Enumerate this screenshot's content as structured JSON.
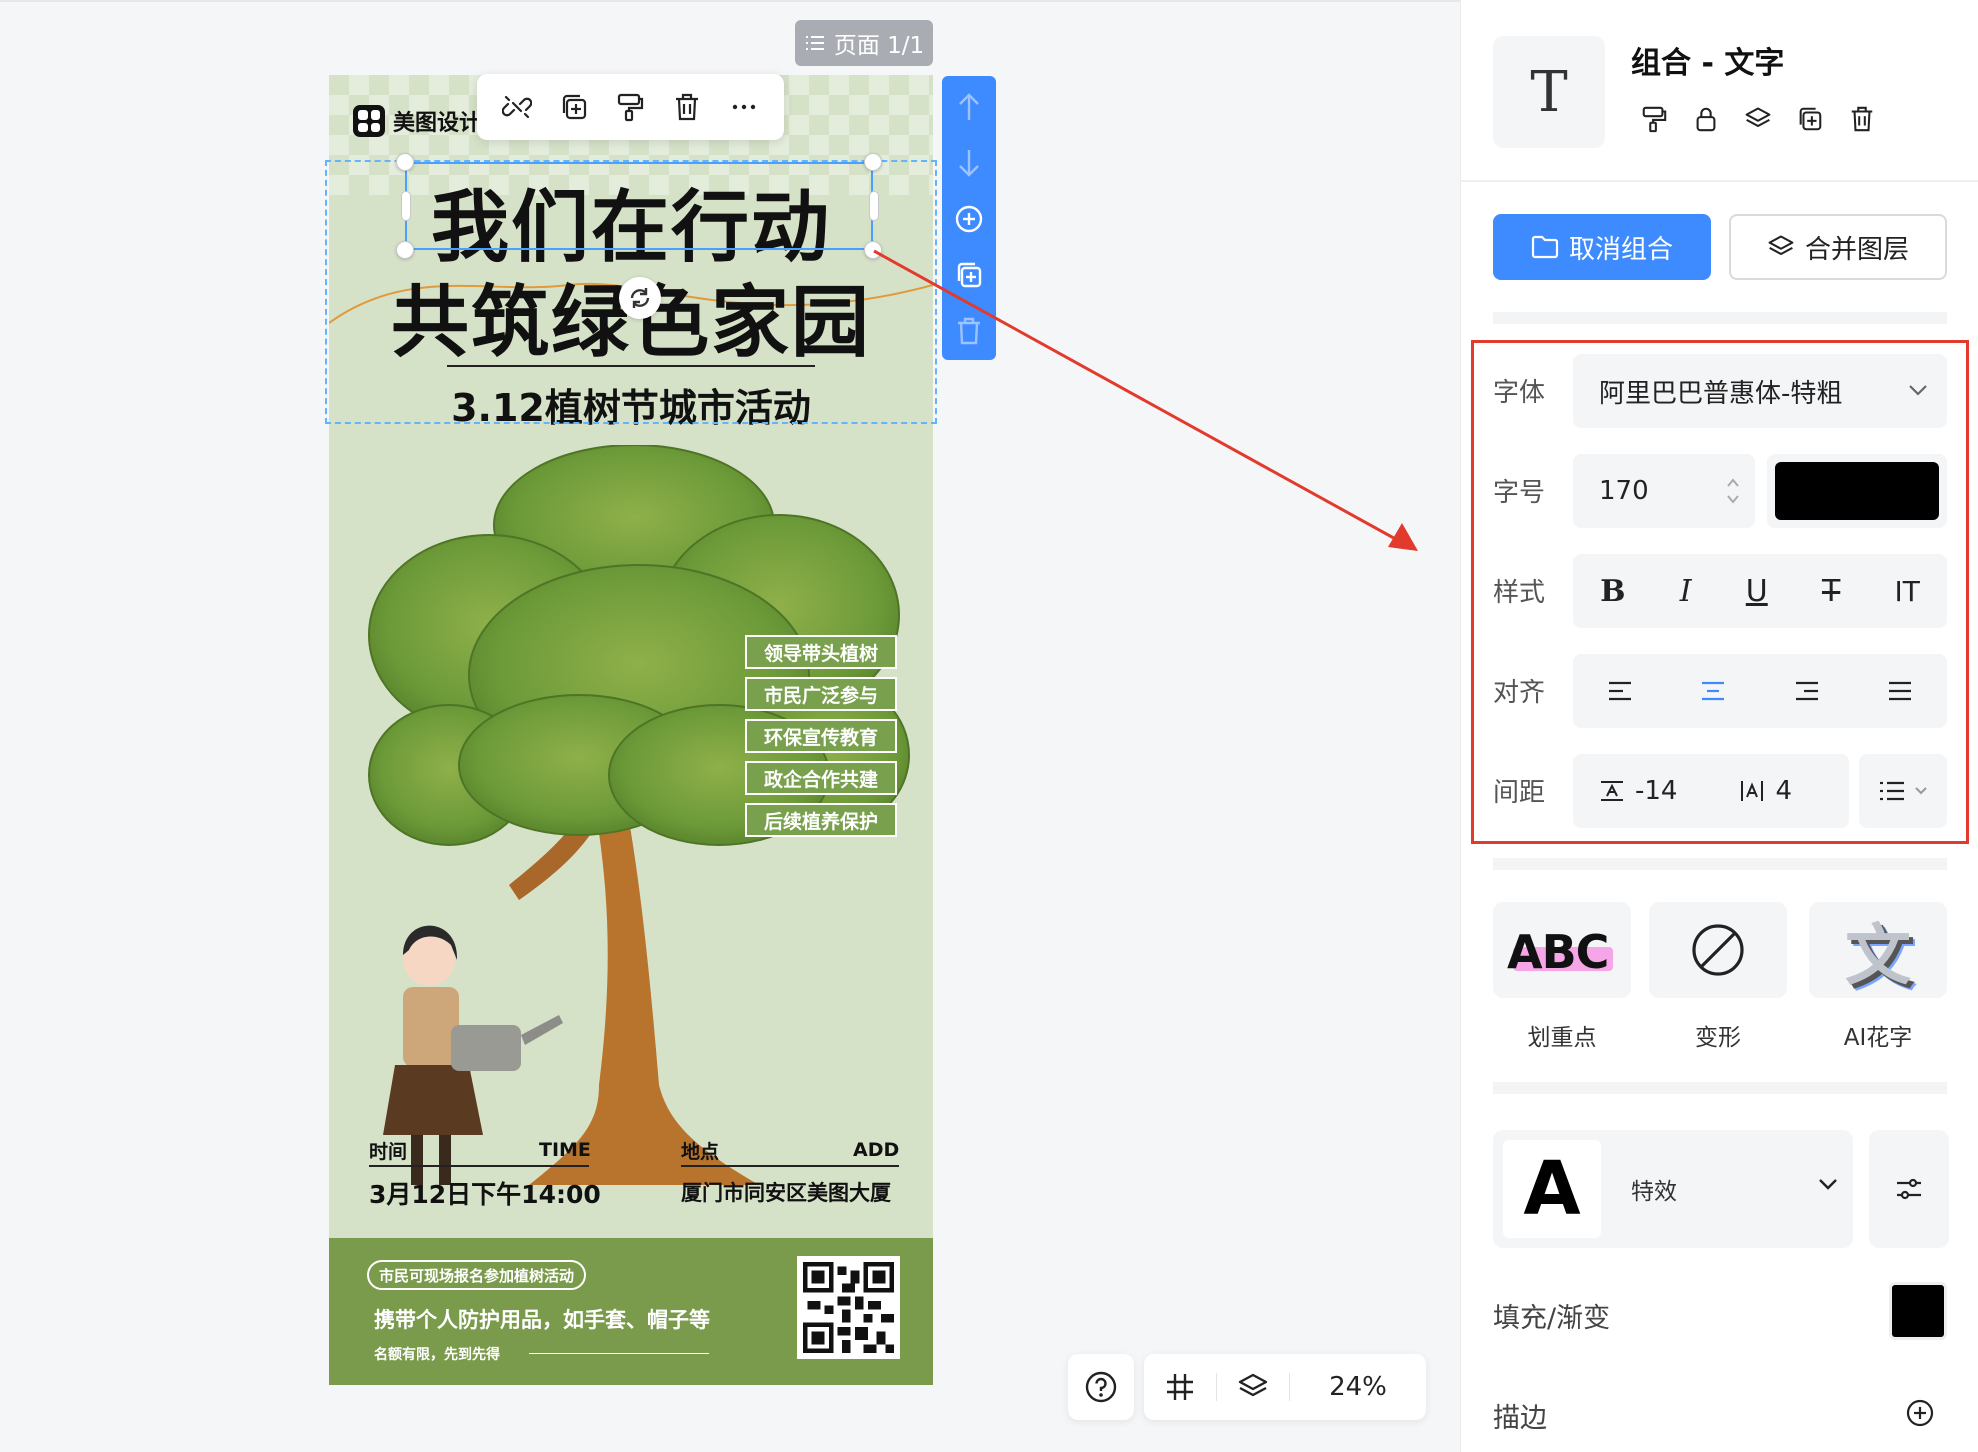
{
  "canvas": {
    "page_indicator": "页面 1/1",
    "zoom": "24%"
  },
  "poster": {
    "brand": "美图设计",
    "headline_1": "我们在行动",
    "headline_2": "共筑绿色家园",
    "subtitle": "3.12植树节城市活动",
    "tags": [
      "领导带头植树",
      "市民广泛参与",
      "环保宣传教育",
      "政企合作共建",
      "后续植养保护"
    ],
    "time_label": "时间",
    "time_label_en": "TIME",
    "time_value": "3月12日下午14:00",
    "place_label": "地点",
    "place_label_en": "ADD",
    "place_value": "厦门市同安区美图大厦",
    "footer_pill": "市民可现场报名参加植树活动",
    "footer_main": "携带个人防护用品，如手套、帽子等",
    "footer_small": "名额有限，先到先得",
    "colors": {
      "bg": "#d6e2c8",
      "tag": "#79a04c",
      "footer": "#7a9a4c"
    }
  },
  "panel": {
    "title": "组合 - 文字",
    "header_icon": "T",
    "ungroup_label": "取消组合",
    "merge_label": "合并图层",
    "font_label": "字体",
    "font_value": "阿里巴巴普惠体-特粗",
    "size_label": "字号",
    "size_value": "170",
    "text_color": "#000000",
    "style_label": "样式",
    "style_buttons": [
      "B",
      "I",
      "U",
      "T",
      "IT"
    ],
    "align_label": "对齐",
    "spacing_label": "间距",
    "letter_spacing": "-14",
    "line_spacing": "4",
    "fx_cards": [
      {
        "label": "划重点",
        "preview": "ABC"
      },
      {
        "label": "变形"
      },
      {
        "label": "AI花字",
        "preview": "文"
      }
    ],
    "effect_label": "特效",
    "effect_preview": "A",
    "fill_label": "填充/渐变",
    "fill_color": "#000000",
    "stroke_label": "描边",
    "accent": "#3d8bff",
    "highlight_border": "#e23a2c"
  }
}
